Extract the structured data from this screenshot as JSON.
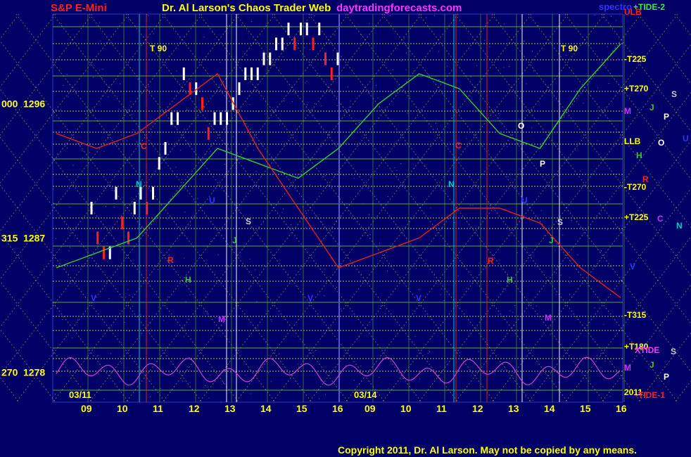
{
  "header": {
    "title": "S&P E-Mini",
    "site": "Dr. Al Larson's Chaos Trader Web",
    "url": "daytradingforecasts.com",
    "spectro_label": "spectro"
  },
  "footer": {
    "copyright": "Copyright 2011, Dr. Al Larson. May not be copied by any means."
  },
  "colors": {
    "background": "#000066",
    "title_red": "#ff2020",
    "yellow_text": "#ffff00",
    "magenta_url": "#ff33ff",
    "grid_green": "#66cc33",
    "grid_yellow": "#dddd55",
    "price_white": "#ffffff",
    "price_red": "#ff2020",
    "tide2_green": "#33cc33",
    "tide1_red": "#dd2222",
    "xtide_magenta": "#cc44cc"
  },
  "chart_data": {
    "type": "line",
    "y_tick_labels": [
      {
        "left": "000",
        "price": "1296",
        "value": 1296
      },
      {
        "left": "315",
        "price": "1287",
        "value": 1287
      },
      {
        "left": "270",
        "price": "1278",
        "value": 1278
      }
    ],
    "ylim": [
      1276,
      1302
    ],
    "date_labels": [
      "03/11",
      "03/14"
    ],
    "x_tick_labels_day1": [
      "09",
      "10",
      "11",
      "12",
      "13",
      "14",
      "15",
      "16"
    ],
    "x_tick_labels_day2": [
      "09",
      "10",
      "11",
      "12",
      "13",
      "14",
      "15",
      "16"
    ],
    "right_levels": [
      {
        "label": "ULB",
        "color": "#ff2020"
      },
      {
        "label": "+TIDE-2",
        "color": "#33ee33"
      },
      {
        "label": "-T225",
        "color": "#ffff00"
      },
      {
        "label": "+T270",
        "color": "#ffff00"
      },
      {
        "label": "M",
        "color": "#cc33ff"
      },
      {
        "label": "LLB",
        "color": "#ffff00"
      },
      {
        "label": "-T270",
        "color": "#ffff00"
      },
      {
        "label": "+T225",
        "color": "#ffff00"
      },
      {
        "label": "V",
        "color": "#3333ff"
      },
      {
        "label": "-T315",
        "color": "#ffff00"
      },
      {
        "label": "+T180",
        "color": "#ffff00"
      },
      {
        "label": "XTIDE",
        "color": "#ff33ff"
      },
      {
        "label": "M",
        "color": "#cc33ff"
      },
      {
        "label": "2011",
        "color": "#ffff00"
      },
      {
        "label": "-TIDE-1",
        "color": "#ff2020"
      }
    ],
    "planet_glyphs": [
      {
        "g": "S",
        "c": "#cccccc"
      },
      {
        "g": "J",
        "c": "#33cc33"
      },
      {
        "g": "P",
        "c": "#ffffff"
      },
      {
        "g": "O",
        "c": "#ffffff"
      },
      {
        "g": "U",
        "c": "#3333ff"
      },
      {
        "g": "H",
        "c": "#33cc33"
      },
      {
        "g": "R",
        "c": "#ff2020"
      },
      {
        "g": "C",
        "c": "#cc33ff"
      },
      {
        "g": "N",
        "c": "#00cccc"
      },
      {
        "g": "S",
        "c": "#cccccc"
      },
      {
        "g": "J",
        "c": "#33cc33"
      },
      {
        "g": "P",
        "c": "#ffffff"
      }
    ],
    "in_chart_labels": [
      {
        "t": "T  90",
        "c": "#ffff00"
      },
      {
        "t": "T  90",
        "c": "#ffff00"
      },
      {
        "t": "C",
        "c": "#ff2020"
      },
      {
        "t": "N",
        "c": "#00cccc"
      },
      {
        "t": "R",
        "c": "#ff2020"
      },
      {
        "t": "H",
        "c": "#33cc33"
      },
      {
        "t": "M",
        "c": "#cc33ff"
      },
      {
        "t": "S",
        "c": "#cccccc"
      },
      {
        "t": "V",
        "c": "#3333ff"
      },
      {
        "t": "U",
        "c": "#3333ff"
      },
      {
        "t": "J",
        "c": "#33cc33"
      },
      {
        "t": "O",
        "c": "#ffffff"
      },
      {
        "t": "P",
        "c": "#ffffff"
      },
      {
        "t": "C",
        "c": "#ff2020"
      },
      {
        "t": "N",
        "c": "#00cccc"
      },
      {
        "t": "R",
        "c": "#ff2020"
      },
      {
        "t": "H",
        "c": "#33cc33"
      },
      {
        "t": "M",
        "c": "#cc33ff"
      },
      {
        "t": "S",
        "c": "#cccccc"
      },
      {
        "t": "V",
        "c": "#3333ff"
      },
      {
        "t": "U",
        "c": "#3333ff"
      },
      {
        "t": "J",
        "c": "#33cc33"
      },
      {
        "t": "V",
        "c": "#3333ff"
      }
    ],
    "series": [
      {
        "name": "price",
        "x": [
          0.0,
          0.2,
          0.4,
          0.6,
          0.8,
          1.0,
          1.2,
          1.4,
          1.6,
          1.8,
          2.0,
          2.2,
          2.4,
          2.6,
          2.8,
          3.0,
          3.2,
          3.4,
          3.6,
          3.8,
          4.0,
          4.2,
          4.4,
          4.6,
          4.8,
          5.0,
          5.2,
          5.4,
          5.6,
          5.8,
          6.0,
          6.2,
          6.4,
          6.6,
          6.8,
          7.0,
          7.2,
          7.4,
          7.6,
          7.8,
          8.0
        ],
        "values": [
          1289,
          1287,
          1286,
          1286,
          1290,
          1288,
          1287,
          1289,
          1290,
          1289,
          1290,
          1292,
          1293,
          1295,
          1295,
          1298,
          1297,
          1297,
          1296,
          1294,
          1295,
          1295,
          1295,
          1296,
          1297,
          1298,
          1298,
          1298,
          1299,
          1299,
          1300,
          1300,
          1301,
          1300,
          1301,
          1301,
          1300,
          1301,
          1299,
          1298,
          1299
        ]
      },
      {
        "name": "TIDE-2",
        "values": [
          1285,
          1286,
          1287,
          1290,
          1293,
          1292,
          1291,
          1293,
          1296,
          1298,
          1297,
          1294,
          1293,
          1297,
          1300
        ]
      },
      {
        "name": "TIDE-1",
        "values": [
          1294,
          1293,
          1294,
          1296,
          1298,
          1293,
          1289,
          1285,
          1286,
          1287,
          1289,
          1289,
          1288,
          1285,
          1283
        ]
      }
    ]
  }
}
